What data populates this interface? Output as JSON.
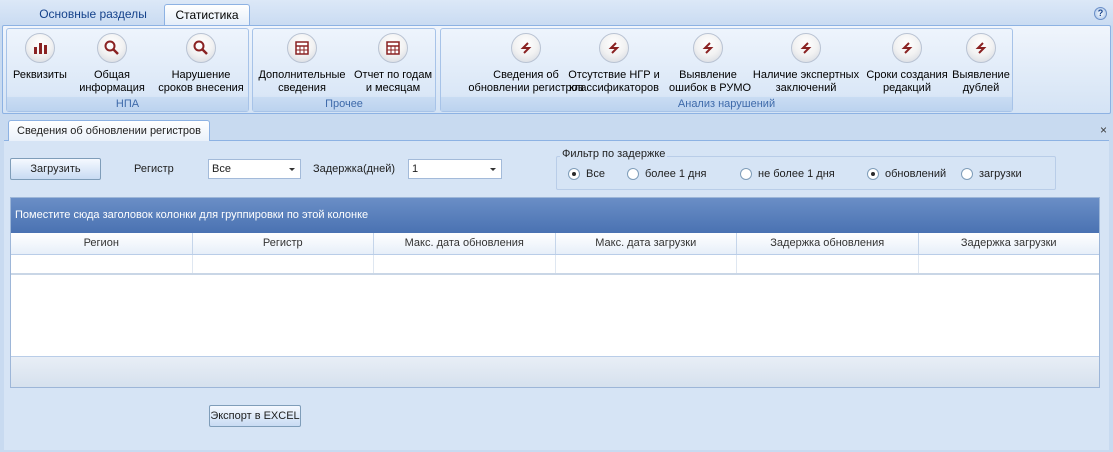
{
  "ribbon_tabs": [
    "Основные разделы",
    "Статистика"
  ],
  "help": "?",
  "groups": {
    "npa": {
      "caption": "НПА",
      "buttons": [
        {
          "label": "Реквизиты",
          "icon": "bar-chart-icon"
        },
        {
          "label": "Общая\nинформация",
          "icon": "magnifier-icon"
        },
        {
          "label": "Нарушение\nсроков внесения",
          "icon": "magnifier-icon"
        }
      ]
    },
    "other": {
      "caption": "Прочее",
      "buttons": [
        {
          "label": "Дополнительные\nсведения",
          "icon": "table-icon"
        },
        {
          "label": "Отчет по годам\nи месяцам",
          "icon": "table-icon"
        }
      ]
    },
    "analysis": {
      "caption": "Анализ нарушений",
      "buttons": [
        {
          "label": "Сведения об\nобновлении регистров",
          "icon": "refresh-arrow-icon"
        },
        {
          "label": "Отсутствие НГР и\nклассификаторов",
          "icon": "refresh-arrow-icon"
        },
        {
          "label": "Выявление\nошибок в РУМО",
          "icon": "refresh-arrow-icon"
        },
        {
          "label": "Наличие экспертных\nзаключений",
          "icon": "refresh-arrow-icon"
        },
        {
          "label": "Сроки создания\nредакций",
          "icon": "refresh-arrow-icon"
        },
        {
          "label": "Выявление\nдублей",
          "icon": "refresh-arrow-icon"
        }
      ]
    }
  },
  "doc_tab": {
    "title": "Сведения об обновлении регистров",
    "close": "×"
  },
  "toolbar": {
    "load_label": "Загрузить",
    "register_label": "Регистр",
    "register_value": "Все",
    "delay_label": "Задержка(дней)",
    "delay_value": "1"
  },
  "filter": {
    "title": "Фильтр по задержке",
    "options": [
      {
        "label": "Все",
        "checked": true
      },
      {
        "label": "более 1 дня",
        "checked": false
      },
      {
        "label": "не более 1 дня",
        "checked": false
      },
      {
        "label": "обновлений",
        "checked": true
      },
      {
        "label": "загрузки",
        "checked": false
      }
    ]
  },
  "grid": {
    "group_panel_text": "Поместите сюда заголовок колонки для группировки по этой колонке",
    "columns": [
      "Регион",
      "Регистр",
      "Макс. дата обновления",
      "Макс. дата загрузки",
      "Задержка обновления",
      "Задержка загрузки"
    ]
  },
  "export_label": "Экспорт в EXCEL"
}
